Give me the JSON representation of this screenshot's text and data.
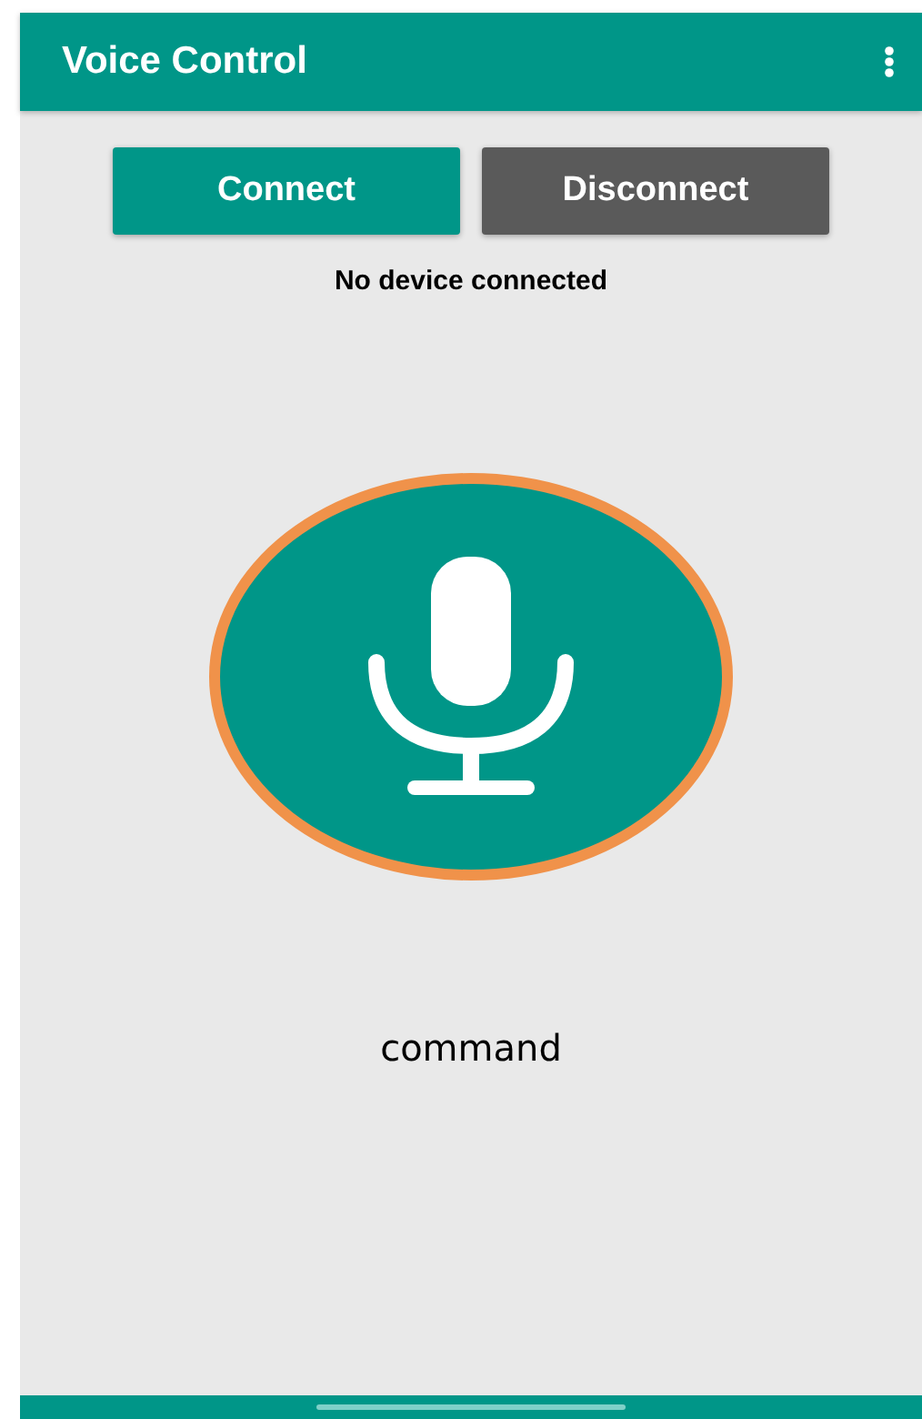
{
  "app_bar": {
    "title": "Voice Control"
  },
  "buttons": [
    {
      "label": "Connect",
      "kind": "primary"
    },
    {
      "label": "Disconnect",
      "kind": "secondary"
    }
  ],
  "status": "No device connected",
  "command": "command"
}
